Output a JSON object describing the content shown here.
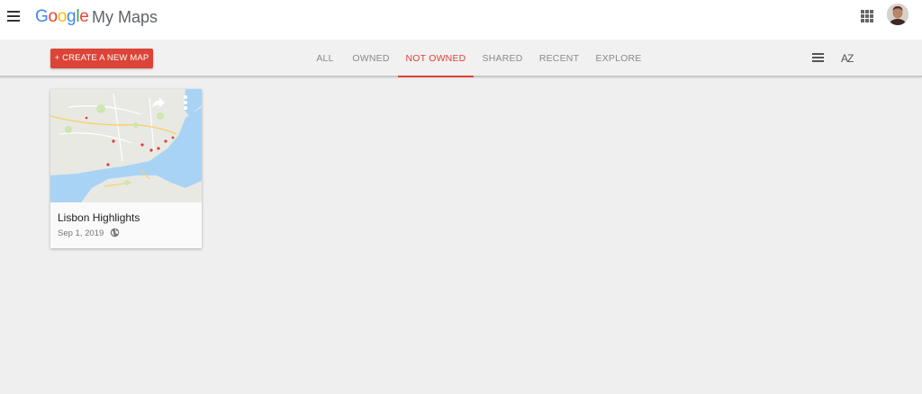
{
  "header": {
    "logo_letters": [
      "G",
      "o",
      "o",
      "g",
      "l",
      "e"
    ],
    "product_name": "My Maps",
    "icons": [
      "menu-icon",
      "apps-grid-icon",
      "account-avatar"
    ]
  },
  "toolbar": {
    "create_button_label": "+ CREATE A NEW MAP",
    "tabs": [
      {
        "label": "ALL",
        "active": false
      },
      {
        "label": "OWNED",
        "active": false
      },
      {
        "label": "NOT OWNED",
        "active": true
      },
      {
        "label": "SHARED",
        "active": false
      },
      {
        "label": "RECENT",
        "active": false
      },
      {
        "label": "EXPLORE",
        "active": false
      }
    ],
    "list_view_icon": "list-view-icon",
    "sort_label": "AZ"
  },
  "maps": [
    {
      "title": "Lisbon Highlights",
      "date": "Sep 1, 2019",
      "visibility_icon": "globe-icon",
      "thumbnail_icons": [
        "share-icon",
        "more-vert-icon"
      ]
    }
  ],
  "colors": {
    "accent": "#db4437",
    "background": "#efefef",
    "water": "#a9d3f5",
    "land": "#e9eae4"
  }
}
